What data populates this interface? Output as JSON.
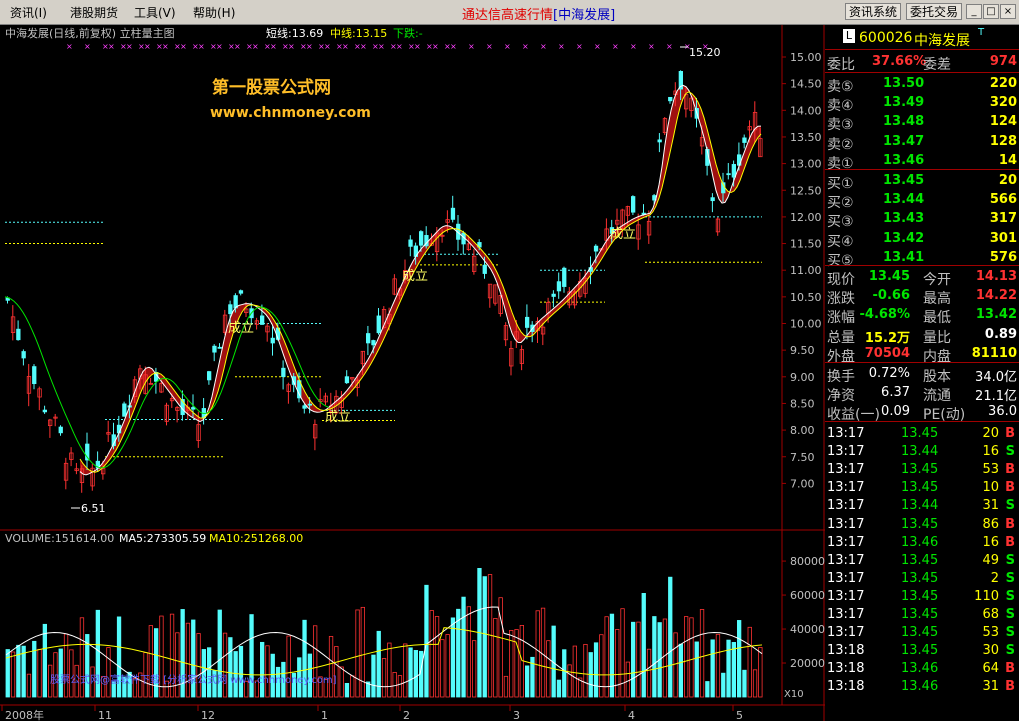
{
  "menu": {
    "items": [
      "资讯(I)",
      "港股期货",
      "工具(V)",
      "帮助(H)"
    ],
    "title": "通达信高速行情",
    "stock_tag": "[中海发展]",
    "btn_info": "资讯系统",
    "btn_trade": "委托交易",
    "win_buttons": [
      "_",
      "□",
      "×"
    ]
  },
  "chart_header": {
    "name": "中海发展(日线,前复权) 立柱量主图",
    "short": "短线:13.69",
    "mid": "中线:13.15",
    "trend": "下跌:-"
  },
  "watermark": {
    "line1": "第一股票公式网",
    "line2": "www.chnmoney.com"
  },
  "markers": {
    "chengli": "成立",
    "high": "15.20",
    "low": "6.51"
  },
  "price_axis": [
    "15.00",
    "14.50",
    "14.00",
    "13.50",
    "13.00",
    "12.50",
    "12.00",
    "11.50",
    "11.00",
    "10.50",
    "10.00",
    "9.50",
    "9.00",
    "8.50",
    "8.00",
    "7.50",
    "7.00"
  ],
  "volume_header": {
    "vol": "VOLUME:151614.00",
    "ma5": "MA5:273305.59",
    "ma10": "MA10:251268.00"
  },
  "volume_axis": [
    "80000",
    "60000",
    "40000",
    "20000"
  ],
  "volume_unit": "X10",
  "volume_footer": "股票公式网@富软件下载 [分析家公式网 www.chnmoney.com]",
  "date_axis": [
    "2008年",
    "11",
    "12",
    "1",
    "2",
    "3",
    "4",
    "5"
  ],
  "colors": {
    "up": "#ff3232",
    "down": "#54fcfc",
    "band": "#a01010",
    "short_line": "#ffffff",
    "mid_line": "#ffff00",
    "green": "#00e600"
  },
  "quote": {
    "code": "600026",
    "name": "中海发展",
    "suffix": "T",
    "weibi_label": "委比",
    "weibi": "37.66%",
    "weicha_label": "委差",
    "weicha": "974",
    "asks": [
      {
        "label": "卖⑤",
        "price": "13.50",
        "vol": "220"
      },
      {
        "label": "卖④",
        "price": "13.49",
        "vol": "320"
      },
      {
        "label": "卖③",
        "price": "13.48",
        "vol": "124"
      },
      {
        "label": "卖②",
        "price": "13.47",
        "vol": "128"
      },
      {
        "label": "卖①",
        "price": "13.46",
        "vol": "14"
      }
    ],
    "bids": [
      {
        "label": "买①",
        "price": "13.45",
        "vol": "20"
      },
      {
        "label": "买②",
        "price": "13.44",
        "vol": "566"
      },
      {
        "label": "买③",
        "price": "13.43",
        "vol": "317"
      },
      {
        "label": "买④",
        "price": "13.42",
        "vol": "301"
      },
      {
        "label": "买⑤",
        "price": "13.41",
        "vol": "576"
      }
    ],
    "stats": [
      {
        "l1": "现价",
        "v1": "13.45",
        "c1": "#00e600",
        "l2": "今开",
        "v2": "14.13",
        "c2": "#ff3232"
      },
      {
        "l1": "涨跌",
        "v1": "-0.66",
        "c1": "#00e600",
        "l2": "最高",
        "v2": "14.22",
        "c2": "#ff3232"
      },
      {
        "l1": "涨幅",
        "v1": "-4.68%",
        "c1": "#00e600",
        "l2": "最低",
        "v2": "13.42",
        "c2": "#00e600"
      },
      {
        "l1": "总量",
        "v1": "15.2万",
        "c1": "#ffff00",
        "l2": "量比",
        "v2": "0.89",
        "c2": "#ffffff"
      },
      {
        "l1": "外盘",
        "v1": "70504",
        "c1": "#ff3232",
        "l2": "内盘",
        "v2": "81110",
        "c2": "#ffff00"
      }
    ],
    "stats2": [
      {
        "l1": "换手",
        "v1": "0.72%",
        "l2": "股本",
        "v2": "34.0亿"
      },
      {
        "l1": "净资",
        "v1": "6.37",
        "l2": "流通",
        "v2": "21.1亿"
      },
      {
        "l1": "收益(一)",
        "v1": "0.09",
        "l2": "PE(动)",
        "v2": "36.0"
      }
    ],
    "ticks": [
      {
        "t": "13:17",
        "p": "13.45",
        "v": "20",
        "s": "B"
      },
      {
        "t": "13:17",
        "p": "13.44",
        "v": "16",
        "s": "S"
      },
      {
        "t": "13:17",
        "p": "13.45",
        "v": "53",
        "s": "B"
      },
      {
        "t": "13:17",
        "p": "13.45",
        "v": "10",
        "s": "B"
      },
      {
        "t": "13:17",
        "p": "13.44",
        "v": "31",
        "s": "S"
      },
      {
        "t": "13:17",
        "p": "13.45",
        "v": "86",
        "s": "B"
      },
      {
        "t": "13:17",
        "p": "13.46",
        "v": "16",
        "s": "B"
      },
      {
        "t": "13:17",
        "p": "13.45",
        "v": "49",
        "s": "S"
      },
      {
        "t": "13:17",
        "p": "13.45",
        "v": "2",
        "s": "S"
      },
      {
        "t": "13:17",
        "p": "13.45",
        "v": "110",
        "s": "S"
      },
      {
        "t": "13:17",
        "p": "13.45",
        "v": "68",
        "s": "S"
      },
      {
        "t": "13:17",
        "p": "13.45",
        "v": "53",
        "s": "S"
      },
      {
        "t": "13:18",
        "p": "13.45",
        "v": "30",
        "s": "S"
      },
      {
        "t": "13:18",
        "p": "13.46",
        "v": "64",
        "s": "B"
      },
      {
        "t": "13:18",
        "p": "13.46",
        "v": "31",
        "s": "B"
      }
    ]
  }
}
